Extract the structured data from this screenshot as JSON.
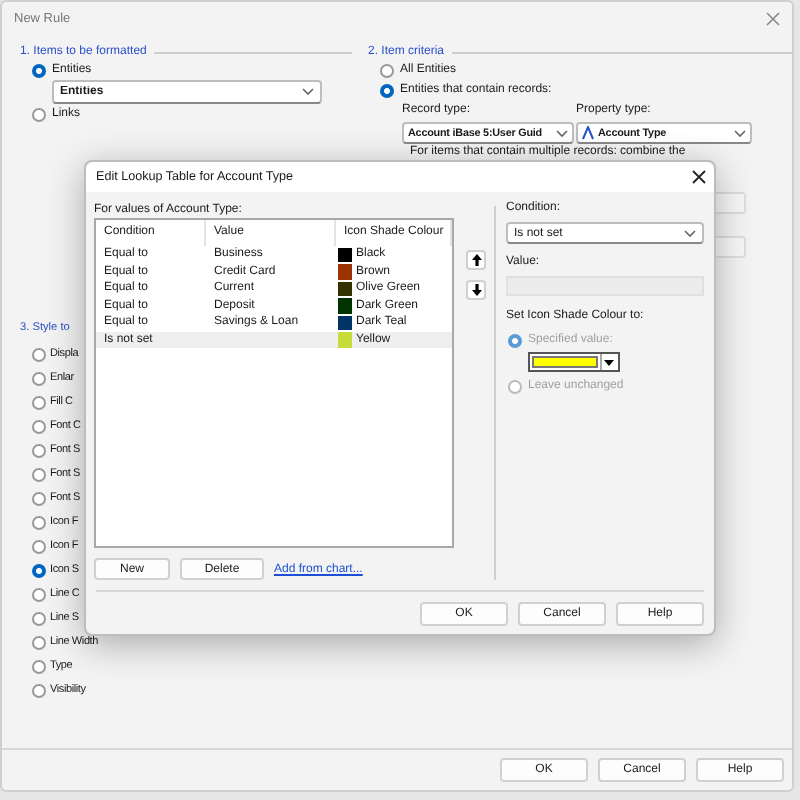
{
  "window": {
    "title": "New Rule"
  },
  "items_section": {
    "heading": "1. Items to be formatted",
    "options": [
      {
        "label": "Entities",
        "selected": true
      },
      {
        "label": "Links",
        "selected": false
      }
    ],
    "dropdown": {
      "value": "Entities"
    }
  },
  "criteria_section": {
    "heading": "2. Item criteria",
    "options": [
      {
        "label": "All Entities",
        "selected": false
      },
      {
        "label": "Entities that contain records:",
        "selected": true
      }
    ],
    "record_type": {
      "label": "Record type:",
      "value": "Account iBase 5:User Guid"
    },
    "property_type": {
      "label": "Property type:",
      "value": "Account Type"
    },
    "note": "For items that contain multiple records: combine the"
  },
  "style_section": {
    "heading": "3. Style to",
    "options": [
      {
        "label": "Displa",
        "selected": false
      },
      {
        "label": "Enlar",
        "selected": false
      },
      {
        "label": "Fill C",
        "selected": false
      },
      {
        "label": "Font C",
        "selected": false
      },
      {
        "label": "Font S",
        "selected": false
      },
      {
        "label": "Font S",
        "selected": false
      },
      {
        "label": "Font S",
        "selected": false
      },
      {
        "label": "Icon F",
        "selected": false
      },
      {
        "label": "Icon F",
        "selected": false
      },
      {
        "label": "Icon S",
        "selected": true
      },
      {
        "label": "Line C",
        "selected": false
      },
      {
        "label": "Line S",
        "selected": false
      },
      {
        "label": "Line Width",
        "selected": false
      },
      {
        "label": "Type",
        "selected": false
      },
      {
        "label": "Visibility",
        "selected": false
      }
    ]
  },
  "buttons": [
    "OK",
    "Cancel",
    "Help"
  ],
  "dialog": {
    "title": "Edit Lookup Table for Account Type",
    "list_label": "For values of Account Type:",
    "columns": [
      "Condition",
      "Value",
      "Icon Shade Colour"
    ],
    "rows": [
      {
        "condition": "Equal to",
        "value": "Business",
        "colour": "Black",
        "color": "#000000",
        "selected": false
      },
      {
        "condition": "Equal to",
        "value": "Credit Card",
        "colour": "Brown",
        "color": "#993300",
        "selected": false
      },
      {
        "condition": "Equal to",
        "value": "Current",
        "colour": "Olive Green",
        "color": "#333300",
        "selected": false
      },
      {
        "condition": "Equal to",
        "value": "Deposit",
        "colour": "Dark Green",
        "color": "#003300",
        "selected": false
      },
      {
        "condition": "Equal to",
        "value": "Savings & Loan",
        "colour": "Dark Teal",
        "color": "#003366",
        "selected": false
      },
      {
        "condition": "Is not set",
        "colour": "Yellow",
        "color": "#c6dc3a",
        "selected": true
      }
    ],
    "list_buttons": [
      "New",
      "Delete"
    ],
    "link": "Add from chart...",
    "condition_label": "Condition:",
    "condition_value": "Is not set",
    "value_label": "Value:",
    "value_field": {
      "disabled": true
    },
    "shade_label": "Set Icon Shade Colour to:",
    "shade_options": [
      {
        "label": "Specified value:",
        "selected": true,
        "disabled": true
      },
      {
        "label": "Leave unchanged",
        "selected": false,
        "disabled": true
      }
    ],
    "shade_swatch": {
      "color": "#ffff00"
    },
    "buttons": [
      "OK",
      "Cancel",
      "Help"
    ]
  }
}
